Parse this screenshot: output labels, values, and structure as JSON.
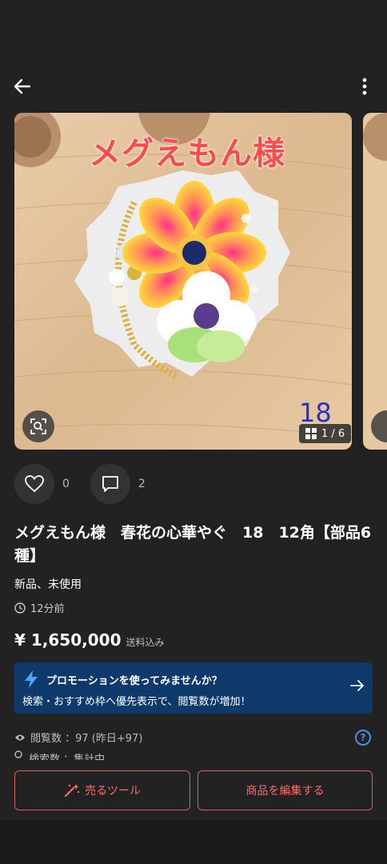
{
  "header": {
    "back_icon": "arrow-left-icon",
    "more_icon": "more-vertical-icon"
  },
  "photo": {
    "overlay_text": "メグえもん様",
    "overlay_number": "18",
    "pager": "1 / 6"
  },
  "actions": {
    "likes": "0",
    "comments": "2"
  },
  "item": {
    "title": "メグえもん様　春花の心華やぐ　18　12角【部品6種】",
    "condition": "新品、未使用",
    "posted": "12分前",
    "price": "¥ 1,650,000",
    "price_note": "送料込み"
  },
  "promo": {
    "title": "プロモーションを使ってみませんか？",
    "subtitle": "検索・おすすめ枠へ優先表示で、閲覧数が増加！",
    "color": "#0d3a6b"
  },
  "stats": {
    "views": "閲覧数 ：97 (昨日+97)",
    "searches": "検索数 ：集計中",
    "help": "?"
  },
  "bottom": {
    "sell_tools": "売るツール",
    "edit_item": "商品を編集する",
    "accent": "#e05a5a"
  }
}
